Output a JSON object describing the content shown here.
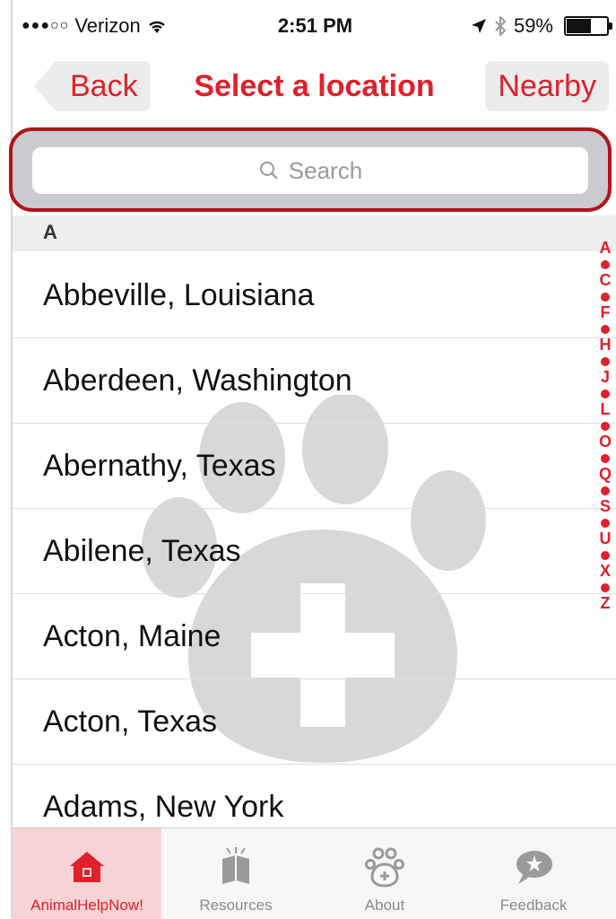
{
  "status_bar": {
    "carrier": "Verizon",
    "time": "2:51 PM",
    "battery": "59%",
    "battery_level": 0.59
  },
  "nav": {
    "back_label": "Back",
    "title": "Select a location",
    "nearby_label": "Nearby"
  },
  "search": {
    "placeholder": "Search"
  },
  "section": {
    "header": "A"
  },
  "locations": [
    "Abbeville, Louisiana",
    "Aberdeen, Washington",
    "Abernathy, Texas",
    "Abilene, Texas",
    "Acton, Maine",
    "Acton, Texas",
    "Adams, New York"
  ],
  "index": [
    "A",
    "C",
    "F",
    "H",
    "J",
    "L",
    "O",
    "Q",
    "S",
    "U",
    "X",
    "Z"
  ],
  "tabs": [
    {
      "label": "AnimalHelpNow!",
      "icon": "house-icon"
    },
    {
      "label": "Resources",
      "icon": "book-icon"
    },
    {
      "label": "About",
      "icon": "paw-icon"
    },
    {
      "label": "Feedback",
      "icon": "speech-bubble-icon"
    }
  ],
  "colors": {
    "accent": "#e0202a",
    "highlight_border": "#b0141c",
    "active_tab_bg": "#f7d3d6"
  }
}
